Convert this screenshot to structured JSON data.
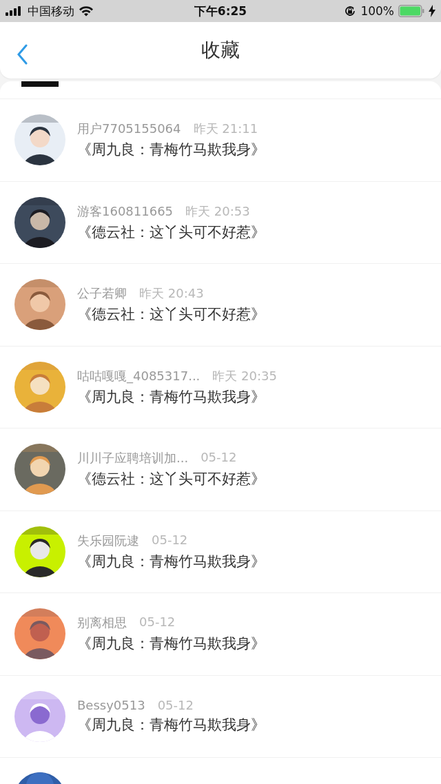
{
  "status_bar": {
    "carrier": "中国移动",
    "time": "下午6:25",
    "battery": "100%"
  },
  "header": {
    "title": "收藏"
  },
  "favorites": [
    {
      "user": "用户7705155064",
      "time": "昨天 21:11",
      "title": "《周九良：青梅竹马欺我身》"
    },
    {
      "user": "游客160811665",
      "time": "昨天 20:53",
      "title": "《德云社：这丫头可不好惹》"
    },
    {
      "user": "公子若卿",
      "time": "昨天 20:43",
      "title": "《德云社：这丫头可不好惹》"
    },
    {
      "user": "咕咕嘎嘎_4085317...",
      "time": "昨天 20:35",
      "title": "《周九良：青梅竹马欺我身》"
    },
    {
      "user": "川川子应聘培训加...",
      "time": "05-12",
      "title": "《德云社：这丫头可不好惹》"
    },
    {
      "user": "失乐园阮逮",
      "time": "05-12",
      "title": "《周九良：青梅竹马欺我身》"
    },
    {
      "user": "别离相思",
      "time": "05-12",
      "title": "《周九良：青梅竹马欺我身》"
    },
    {
      "user": "Bessy0513",
      "time": "05-12",
      "title": "《周九良：青梅竹马欺我身》"
    }
  ]
}
